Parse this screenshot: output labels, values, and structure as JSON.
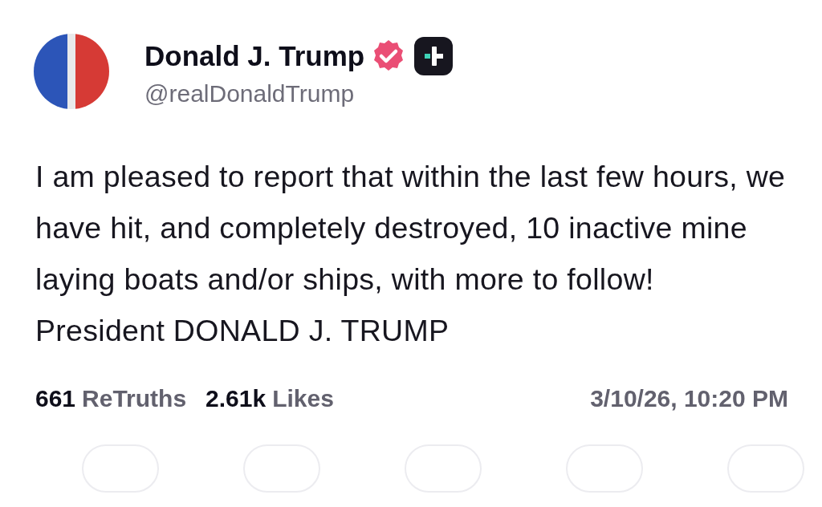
{
  "author": {
    "name": "Donald J. Trump",
    "handle": "@realDonaldTrump"
  },
  "post": {
    "text": "I am pleased to report that within the last few hours, we have hit, and completely destroyed, 10 inactive mine laying boats and/or ships, with more to follow!\nPresident DONALD J. TRUMP"
  },
  "stats": [
    {
      "count": "661",
      "label": "ReTruths"
    },
    {
      "count": "2.61k",
      "label": "Likes"
    }
  ],
  "timestamp": "3/10/26, 10:20 PM"
}
